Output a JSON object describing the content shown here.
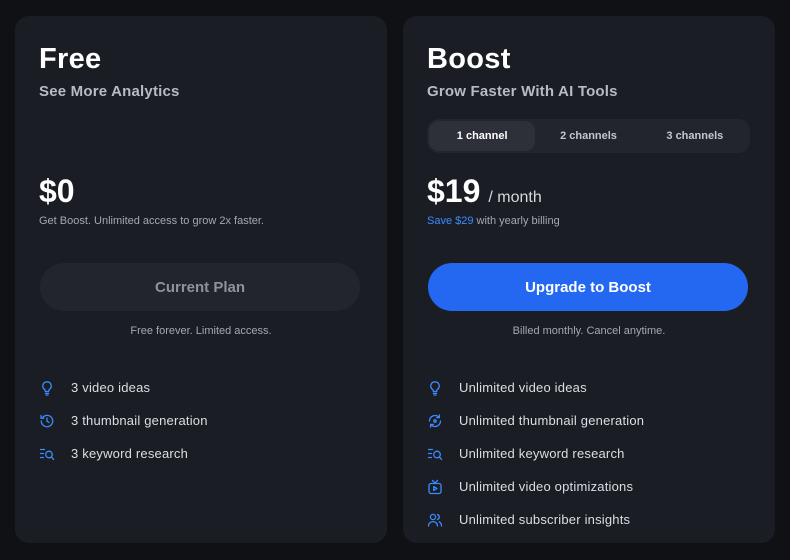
{
  "plans": {
    "free": {
      "title": "Free",
      "subtitle": "See More Analytics",
      "price": "$0",
      "description": "Get Boost. Unlimited access to grow 2x faster.",
      "button_label": "Current Plan",
      "note": "Free forever. Limited access.",
      "features": [
        {
          "icon": "lightbulb-icon",
          "label": "3 video ideas"
        },
        {
          "icon": "history-icon",
          "label": "3 thumbnail generation"
        },
        {
          "icon": "list-search-icon",
          "label": "3 keyword research"
        }
      ]
    },
    "boost": {
      "title": "Boost",
      "subtitle": "Grow Faster With AI Tools",
      "channel_options": [
        "1 channel",
        "2 channels",
        "3 channels"
      ],
      "selected_channel": "1 channel",
      "price": "$19",
      "price_unit": "/ month",
      "save_text": "Save $29",
      "save_suffix": " with yearly billing",
      "button_label": "Upgrade to Boost",
      "note": "Billed monthly. Cancel anytime.",
      "features": [
        {
          "icon": "lightbulb-icon",
          "label": "Unlimited video ideas"
        },
        {
          "icon": "refresh-icon",
          "label": "Unlimited thumbnail generation"
        },
        {
          "icon": "list-search-icon",
          "label": "Unlimited keyword research"
        },
        {
          "icon": "video-optimize-icon",
          "label": "Unlimited video optimizations"
        },
        {
          "icon": "users-icon",
          "label": "Unlimited subscriber insights"
        }
      ]
    }
  },
  "colors": {
    "background": "#101115",
    "card": "#1b1d24",
    "accent": "#2468f2",
    "link": "#3b8bff",
    "icon": "#3b8bff"
  }
}
